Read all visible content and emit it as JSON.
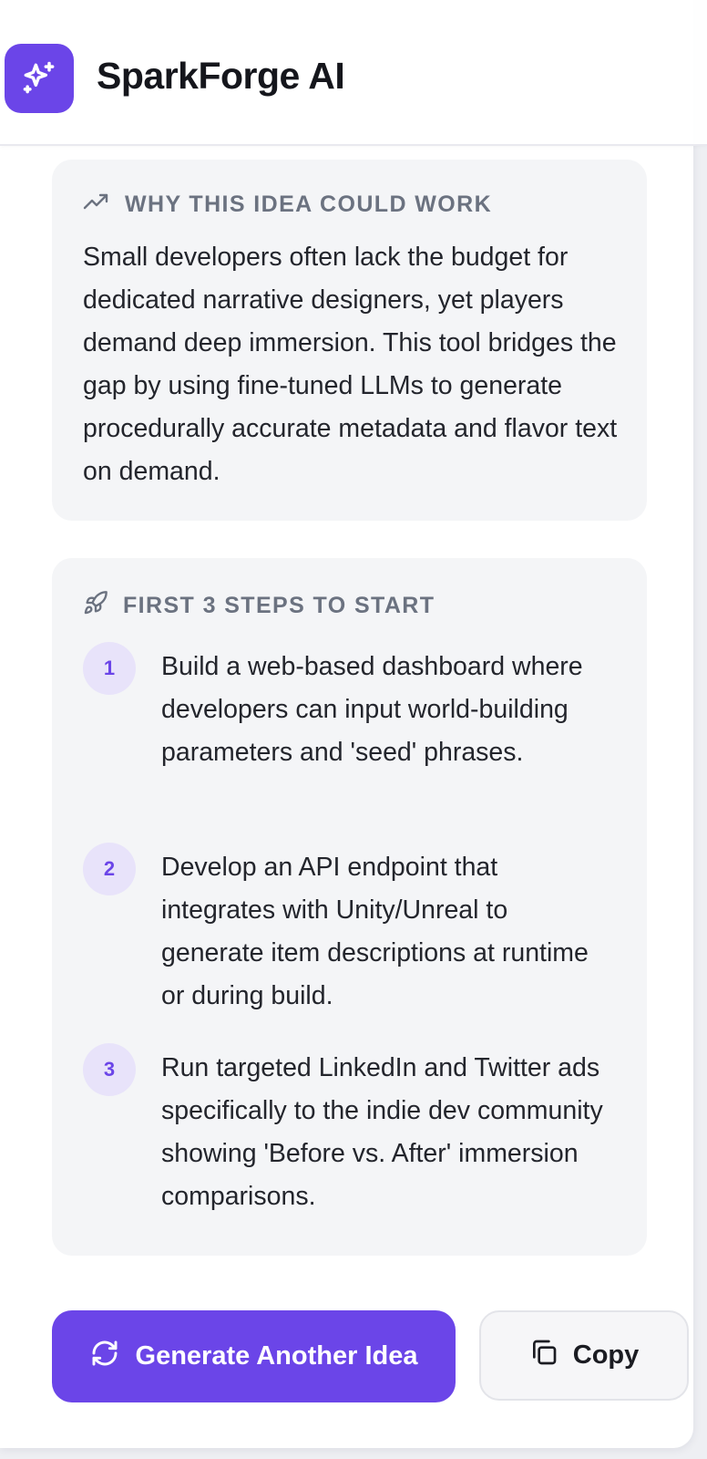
{
  "header": {
    "app_name": "SparkForge AI",
    "logo_icon": "sparkles-icon",
    "accent_color": "#6b45e8"
  },
  "why": {
    "title": "WHY THIS IDEA COULD WORK",
    "icon": "trending-up-icon",
    "text": "Small developers often lack the budget for dedicated narrative designers, yet players demand deep immersion. This tool bridges the gap by using fine-tuned LLMs to generate procedurally accurate metadata and flavor text on demand."
  },
  "steps": {
    "title": "FIRST 3 STEPS TO START",
    "icon": "rocket-icon",
    "items": [
      {
        "number": "1",
        "text": "Build a web-based dashboard where developers can input world-building parameters and 'seed' phrases."
      },
      {
        "number": "2",
        "text": "Develop an API endpoint that integrates with Unity/Unreal to generate item descriptions at runtime or during build."
      },
      {
        "number": "3",
        "text": "Run targeted LinkedIn and Twitter ads specifically to the indie dev community showing 'Before vs. After' immersion comparisons."
      }
    ]
  },
  "actions": {
    "generate_label": "Generate Another Idea",
    "generate_icon": "refresh-icon",
    "copy_label": "Copy",
    "copy_icon": "copy-icon"
  }
}
